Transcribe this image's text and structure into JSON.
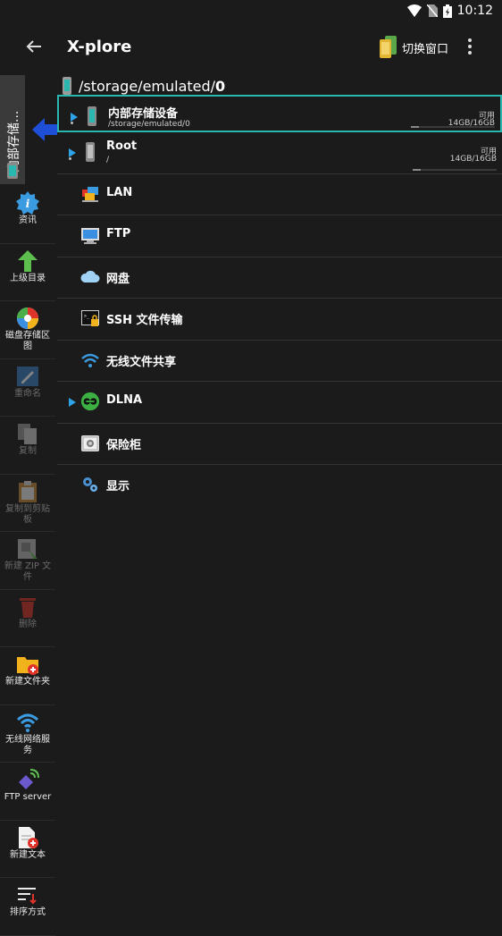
{
  "status": {
    "time": "10:12"
  },
  "appbar": {
    "title": "X-plore",
    "switch_label": "切换窗口"
  },
  "pane": {
    "vertical_tab": "内部存储..."
  },
  "path": {
    "prefix": "/storage/emulated/",
    "last": "0"
  },
  "list": {
    "internal": {
      "name": "内部存储设备",
      "sub": "/storage/emulated/0",
      "avail": "可用",
      "size": "14GB/16GB",
      "used": 0.1
    },
    "root": {
      "name": "Root",
      "sub": "/",
      "avail": "可用",
      "size": "14GB/16GB",
      "used": 0.1
    },
    "lan": "LAN",
    "ftp": "FTP",
    "cloud": "网盘",
    "ssh": "SSH 文件传输",
    "wifi": "无线文件共享",
    "dlna": "DLNA",
    "vault": "保险柜",
    "display": "显示"
  },
  "toolbar": {
    "info": "资讯",
    "up": "上级目录",
    "disk_map": "磁盘存储区图",
    "rename": "重命名",
    "copy": "复制",
    "clipboard": "复制到剪贴板",
    "new_zip": "新建 ZIP 文件",
    "delete": "删除",
    "new_folder": "新建文件夹",
    "wifi_server": "无线网络服务",
    "ftp_server": "FTP server",
    "new_text": "新建文本",
    "sort": "排序方式"
  },
  "colors": {
    "accent": "#2ab7b0",
    "arrow": "#1f4fd6",
    "info": "#3a9be0"
  }
}
